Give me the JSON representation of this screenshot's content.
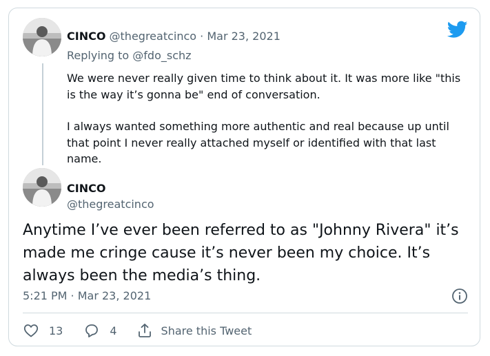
{
  "colors": {
    "brand": "#1d9bf0",
    "text": "#0f1419",
    "muted": "#536471",
    "border": "#cfd9de"
  },
  "reply_tweet": {
    "author_name": "CINCO",
    "author_handle": "@thegreatcinco",
    "separator": "·",
    "date": "Mar 23, 2021",
    "replying_prefix": "Replying to",
    "replying_handle": "@fdo_schz",
    "paragraphs": [
      "We were never really given time to think about it. It was more like \"this is the way it’s gonna be\" end of conversation.",
      "I always wanted something more authentic and real because up until that point I never really attached myself or identified with that last name."
    ]
  },
  "main_tweet": {
    "author_name": "CINCO",
    "author_handle": "@thegreatcinco",
    "text": "Anytime I’ve ever been referred to as \"Johnny Rivera\" it’s made me cringe cause it’s never been my choice.  It’s always been the media’s thing.",
    "timestamp": "5:21 PM · Mar 23, 2021",
    "likes": "13",
    "replies": "4",
    "share_label": "Share this Tweet"
  },
  "icons": {
    "logo": "twitter-bird-icon",
    "info": "info-icon",
    "like": "heart-icon",
    "reply": "comment-icon",
    "share": "share-icon"
  }
}
